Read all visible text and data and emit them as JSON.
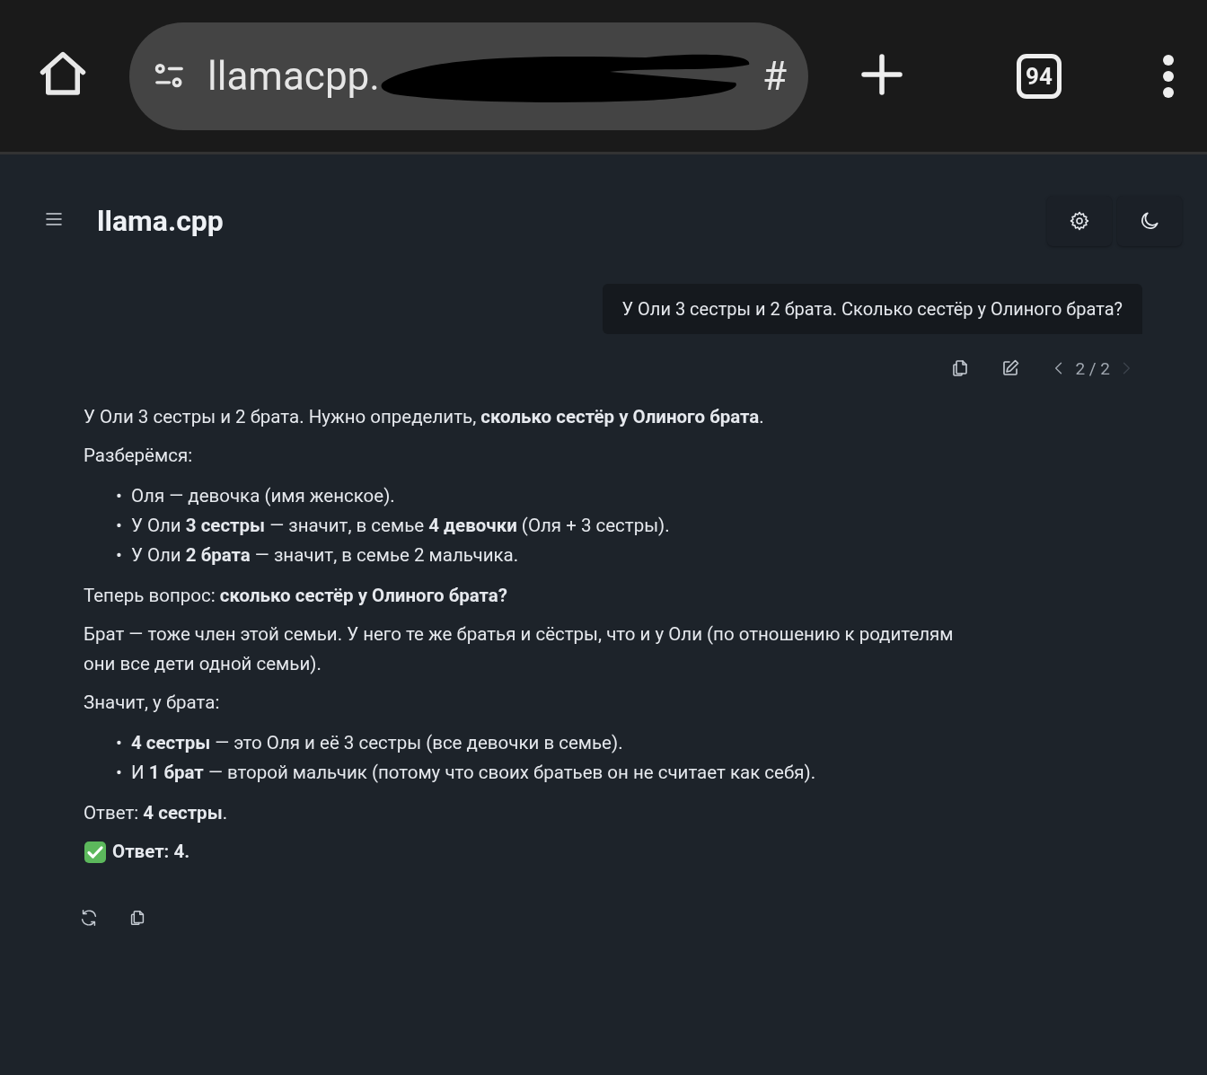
{
  "browser": {
    "url_start": "llamacpp.",
    "url_end": "#",
    "tab_count": "94"
  },
  "header": {
    "title": "llama.cpp"
  },
  "user_message": {
    "text": "У Оли 3 сестры и 2 брата. Сколько сестёр у Олиного брата?",
    "pager": "2 / 2",
    "prev_disabled": false,
    "next_disabled": true
  },
  "assistant_message": {
    "blocks": [
      {
        "kind": "p",
        "text": "У Оли 3 сестры и 2 брата. Нужно определить, **сколько сестёр у Олиного брата**."
      },
      {
        "kind": "p",
        "text": "Разберёмся:"
      },
      {
        "kind": "ul",
        "marker": "•",
        "items": [
          "Оля — девочка (имя женское).",
          "У Оли **3 сестры** — значит, в семье **4 девочки** (Оля + 3 сестры).",
          "У Оли **2 брата** — значит, в семье 2 мальчика."
        ]
      },
      {
        "kind": "p",
        "text": "Теперь вопрос: **сколько сестёр у Олиного брата?**"
      },
      {
        "kind": "p",
        "text": "Брат — тоже член этой семьи. У него те же братья и сёстры, что и у Оли (по отношению к родителям они все дети одной семьи)."
      },
      {
        "kind": "p",
        "text": "Значит, у брата:"
      },
      {
        "kind": "ul",
        "marker": "•",
        "items": [
          "**4 сестры** — это Оля и её 3 сестры (все девочки в семье).",
          "И **1 брат** — второй мальчик (потому что своих братьев он не считает как себя)."
        ]
      },
      {
        "kind": "p",
        "text": "Ответ: **4 сестры**."
      },
      {
        "kind": "verdict",
        "text": "Ответ: 4."
      }
    ]
  }
}
